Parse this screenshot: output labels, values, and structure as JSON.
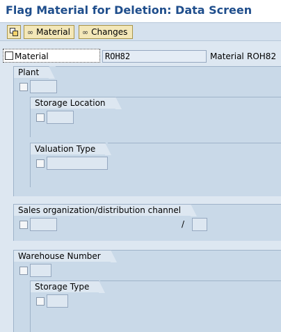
{
  "title": "Flag Material for Deletion: Data Screen",
  "toolbar": {
    "copy_button_label": "",
    "material_button_label": "Material",
    "changes_button_label": "Changes"
  },
  "material_row": {
    "checkbox_label": "Material",
    "input_value": "ROH82",
    "right_label": "Material",
    "right_value": "ROH82"
  },
  "groups": {
    "plant": {
      "title": "Plant"
    },
    "storage_location": {
      "title": "Storage Location"
    },
    "valuation_type": {
      "title": "Valuation Type"
    },
    "sales_org": {
      "title": "Sales organization/distribution channel",
      "separator": "/"
    },
    "warehouse": {
      "title": "Warehouse Number"
    },
    "storage_type": {
      "title": "Storage Type"
    }
  },
  "colors": {
    "title": "#1f4e8c",
    "toolbar_bg": "#d5e1ee",
    "button_bg": "#f3e7b8",
    "content_bg": "#dde7f1",
    "group_bg": "#c9d9e8"
  },
  "icons": {
    "copy": "copy-icon",
    "display": "glasses-icon"
  }
}
